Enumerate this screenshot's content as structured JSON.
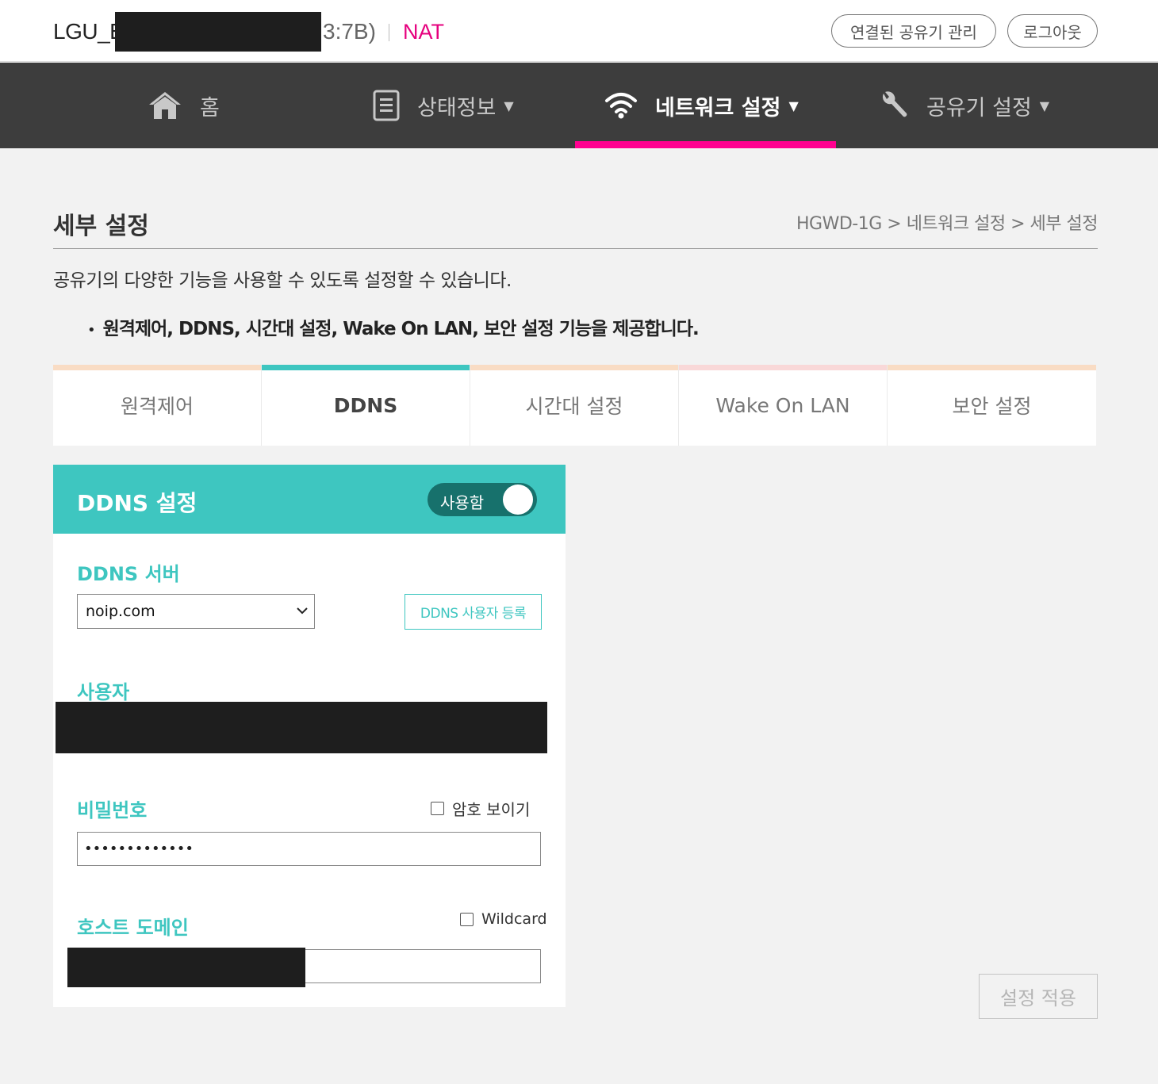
{
  "header": {
    "device_prefix": "LGU_E",
    "device_suffix": "3:7B)",
    "mode": "NAT",
    "manage_button": "연결된 공유기 관리",
    "logout_button": "로그아웃"
  },
  "nav": {
    "items": [
      {
        "label": "홈",
        "icon": "home-icon"
      },
      {
        "label": "상태정보",
        "icon": "document-icon"
      },
      {
        "label": "네트워크 설정",
        "icon": "wifi-icon"
      },
      {
        "label": "공유기 설정",
        "icon": "wrench-icon"
      }
    ],
    "active_index": 2,
    "accent_color": "#ff0090"
  },
  "page": {
    "title": "세부 설정",
    "breadcrumb": "HGWD-1G > 네트워크 설정 > 세부 설정",
    "description": "공유기의 다양한 기능을 사용할 수 있도록 설정할 수 있습니다.",
    "feature_note": "원격제어, DDNS, 시간대 설정, Wake On LAN, 보안 설정 기능을 제공합니다."
  },
  "tabs": {
    "items": [
      {
        "label": "원격제어",
        "bar_color": "#f9dcc4"
      },
      {
        "label": "DDNS",
        "bar_color": "#3ec6c0"
      },
      {
        "label": "시간대 설정",
        "bar_color": "#f9dcc4"
      },
      {
        "label": "Wake On LAN",
        "bar_color": "#f9d8d8"
      },
      {
        "label": "보안 설정",
        "bar_color": "#f9dcc4"
      }
    ],
    "active_index": 1
  },
  "ddns": {
    "title": "DDNS 설정",
    "toggle_label": "사용함",
    "toggle_on": true,
    "server_label": "DDNS 서버",
    "server_value": "noip.com",
    "register_button": "DDNS 사용자 등록",
    "user_label": "사용자",
    "password_label": "비밀번호",
    "show_password_label": "암호 보이기",
    "show_password_checked": false,
    "password_value": "•••••••••••••",
    "host_label": "호스트 도메인",
    "wildcard_label": "Wildcard",
    "wildcard_checked": false,
    "accent_color": "#3ec6c0"
  },
  "footer": {
    "apply_button": "설정 적용"
  }
}
